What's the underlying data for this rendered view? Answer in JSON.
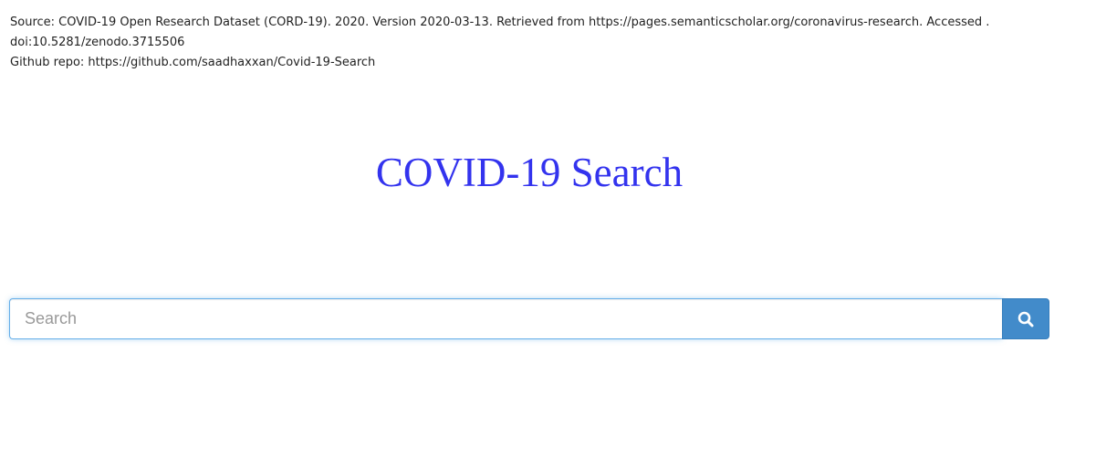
{
  "source": {
    "citation_line1": "Source: COVID-19 Open Research Dataset (CORD-19). 2020. Version 2020-03-13. Retrieved from https://pages.semanticscholar.org/coronavirus-research. Accessed .",
    "citation_line2": "doi:10.5281/zenodo.3715506",
    "github_line": "Github repo: https://github.com/saadhaxxan/Covid-19-Search"
  },
  "header": {
    "title": "COVID-19 Search",
    "title_color": "#3333ee"
  },
  "search": {
    "placeholder": "Search",
    "value": "",
    "button_icon": "search-icon",
    "button_color": "#428bca"
  }
}
